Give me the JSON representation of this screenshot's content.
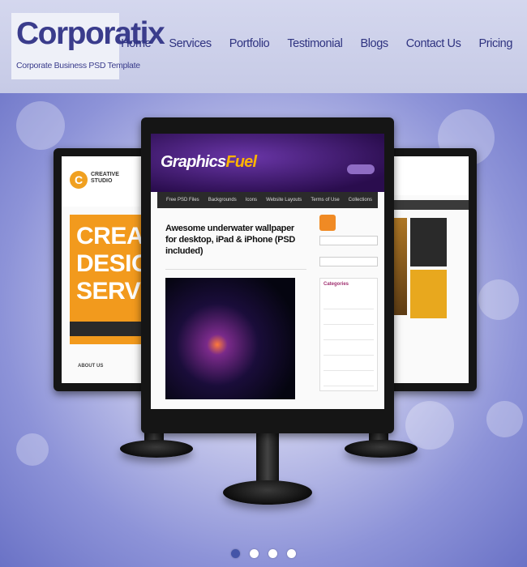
{
  "logo": {
    "title": "Corporatix",
    "subtitle": "Corporate Business PSD Template"
  },
  "nav": {
    "items": [
      {
        "label": "Home"
      },
      {
        "label": "Services"
      },
      {
        "label": "Portfolio"
      },
      {
        "label": "Testimonial"
      },
      {
        "label": "Blogs"
      },
      {
        "label": "Contact Us"
      },
      {
        "label": "Pricing"
      }
    ]
  },
  "slider": {
    "left_screen": {
      "logo_text": "CREATIVE STUDIO",
      "headline": "CREATIVE DESIGN SERVICE",
      "section_label": "ABOUT US"
    },
    "center_screen": {
      "brand": "GraphicsFuel",
      "nav": [
        "Free PSD Files",
        "Backgrounds",
        "Icons",
        "Website Layouts",
        "Terms of Use",
        "Collections"
      ],
      "post_title": "Awesome underwater wallpaper for desktop, iPad & iPhone (PSD included)",
      "sidebar_heading": "Categories"
    },
    "dots": [
      {
        "active": true
      },
      {
        "active": false
      },
      {
        "active": false
      },
      {
        "active": false
      }
    ]
  },
  "colors": {
    "brand": "#3a3c8c",
    "nav_text": "#2f3380",
    "header_bg": "#cdd0ea",
    "dot_active": "#4455a8"
  }
}
